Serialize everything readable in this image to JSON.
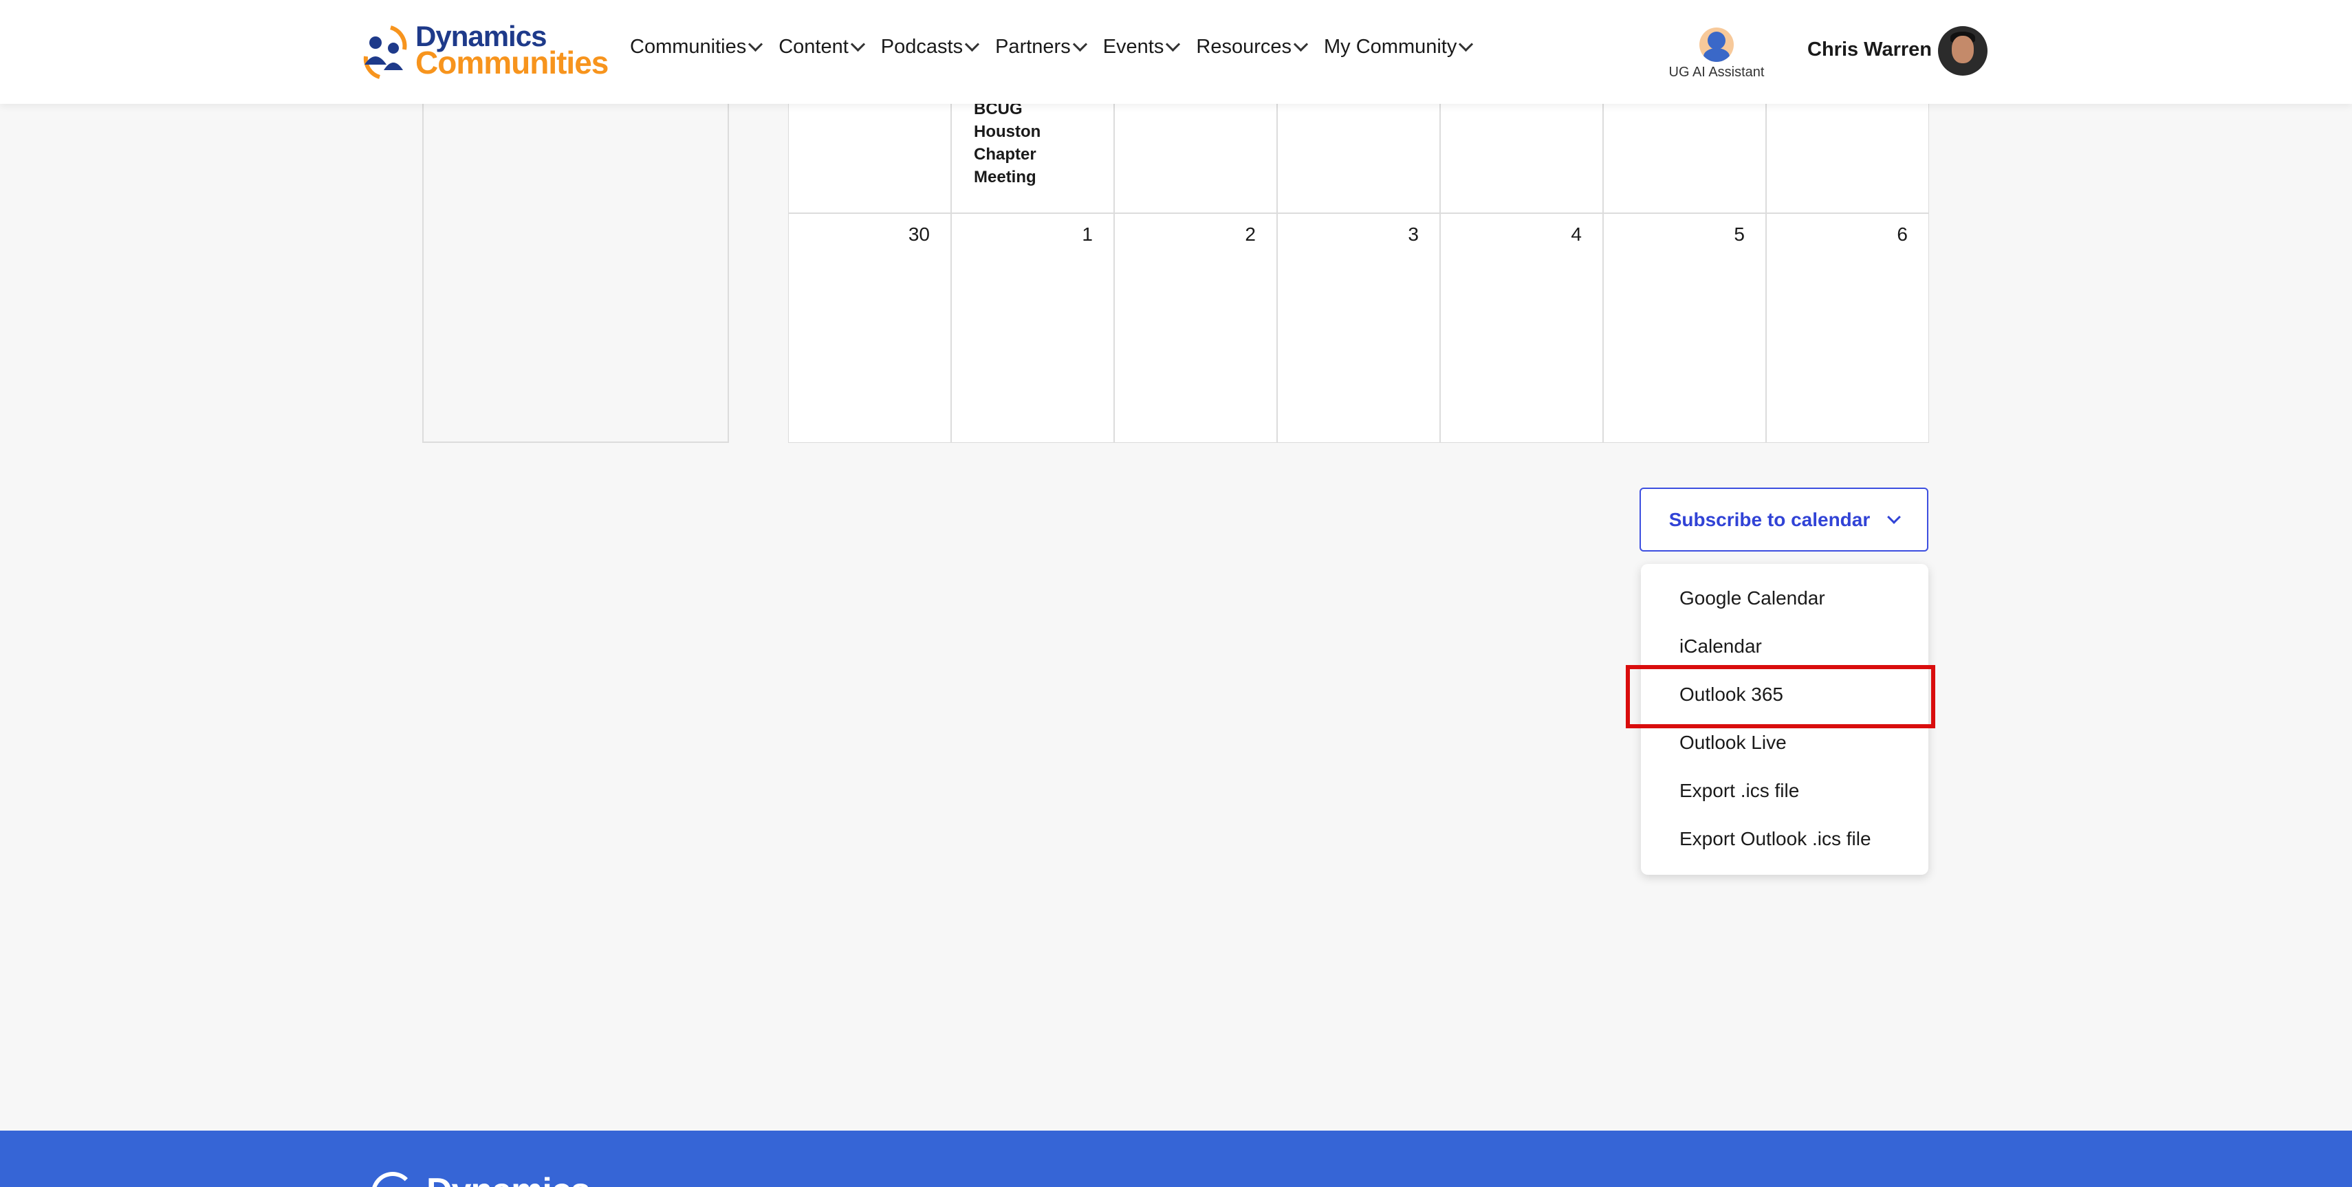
{
  "header": {
    "logo": {
      "line1": "Dynamics",
      "line2": "Communities"
    },
    "nav": [
      {
        "label": "Communities"
      },
      {
        "label": "Content"
      },
      {
        "label": "Podcasts"
      },
      {
        "label": "Partners"
      },
      {
        "label": "Events"
      },
      {
        "label": "Resources"
      },
      {
        "label": "My Community"
      }
    ],
    "ai_assistant_label": "UG AI Assistant",
    "user_name": "Chris Warren"
  },
  "calendar": {
    "row1": [
      {
        "day": "",
        "event": ""
      },
      {
        "day": "",
        "event": "BCUG Houston Chapter Meeting"
      },
      {
        "day": "",
        "event": ""
      },
      {
        "day": "",
        "event": ""
      },
      {
        "day": "",
        "event": ""
      },
      {
        "day": "",
        "event": ""
      },
      {
        "day": "",
        "event": ""
      }
    ],
    "row2": [
      {
        "day": "30"
      },
      {
        "day": "1"
      },
      {
        "day": "2"
      },
      {
        "day": "3"
      },
      {
        "day": "4"
      },
      {
        "day": "5"
      },
      {
        "day": "6"
      }
    ]
  },
  "subscribe": {
    "button_label": "Subscribe to calendar",
    "options": [
      "Google Calendar",
      "iCalendar",
      "Outlook 365",
      "Outlook Live",
      "Export .ics file",
      "Export Outlook .ics file"
    ],
    "highlighted": "Outlook 365"
  },
  "footer": {
    "logo_text": "Dynamics"
  },
  "colors": {
    "brand_blue": "#1e3a8a",
    "brand_orange": "#f7941d",
    "accent": "#3143d6",
    "highlight": "#d90d0d",
    "footer": "#3665d6"
  }
}
